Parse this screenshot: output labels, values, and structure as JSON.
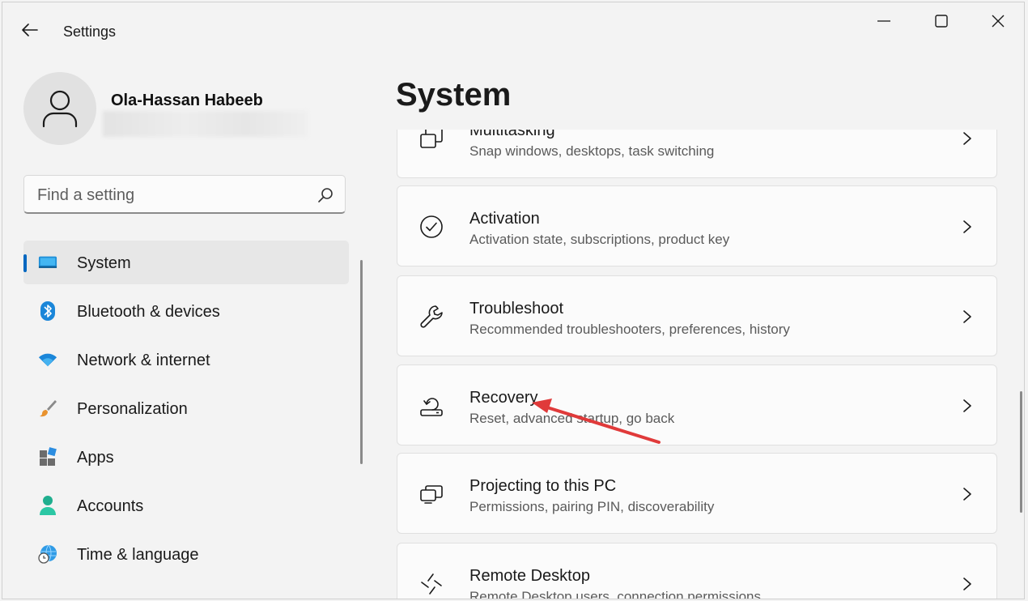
{
  "window": {
    "title": "Settings"
  },
  "profile": {
    "name": "Ola-Hassan Habeeb"
  },
  "search": {
    "placeholder": "Find a setting"
  },
  "sidebar": {
    "items": [
      {
        "label": "System",
        "icon": "system-icon",
        "active": true
      },
      {
        "label": "Bluetooth & devices",
        "icon": "bluetooth-icon"
      },
      {
        "label": "Network & internet",
        "icon": "wifi-icon"
      },
      {
        "label": "Personalization",
        "icon": "paintbrush-icon"
      },
      {
        "label": "Apps",
        "icon": "apps-icon"
      },
      {
        "label": "Accounts",
        "icon": "person-icon"
      },
      {
        "label": "Time & language",
        "icon": "globe-clock-icon"
      }
    ]
  },
  "main": {
    "title": "System",
    "cards": [
      {
        "title": "Multitasking",
        "subtitle": "Snap windows, desktops, task switching",
        "icon": "multitasking-icon"
      },
      {
        "title": "Activation",
        "subtitle": "Activation state, subscriptions, product key",
        "icon": "checkmark-circle-icon"
      },
      {
        "title": "Troubleshoot",
        "subtitle": "Recommended troubleshooters, preferences, history",
        "icon": "wrench-icon"
      },
      {
        "title": "Recovery",
        "subtitle": "Reset, advanced startup, go back",
        "icon": "recovery-icon"
      },
      {
        "title": "Projecting to this PC",
        "subtitle": "Permissions, pairing PIN, discoverability",
        "icon": "projecting-icon"
      },
      {
        "title": "Remote Desktop",
        "subtitle": "Remote Desktop users, connection permissions",
        "icon": "remote-desktop-icon"
      }
    ]
  },
  "colors": {
    "accent": "#0067c0",
    "annotation": "#e03a3a"
  }
}
